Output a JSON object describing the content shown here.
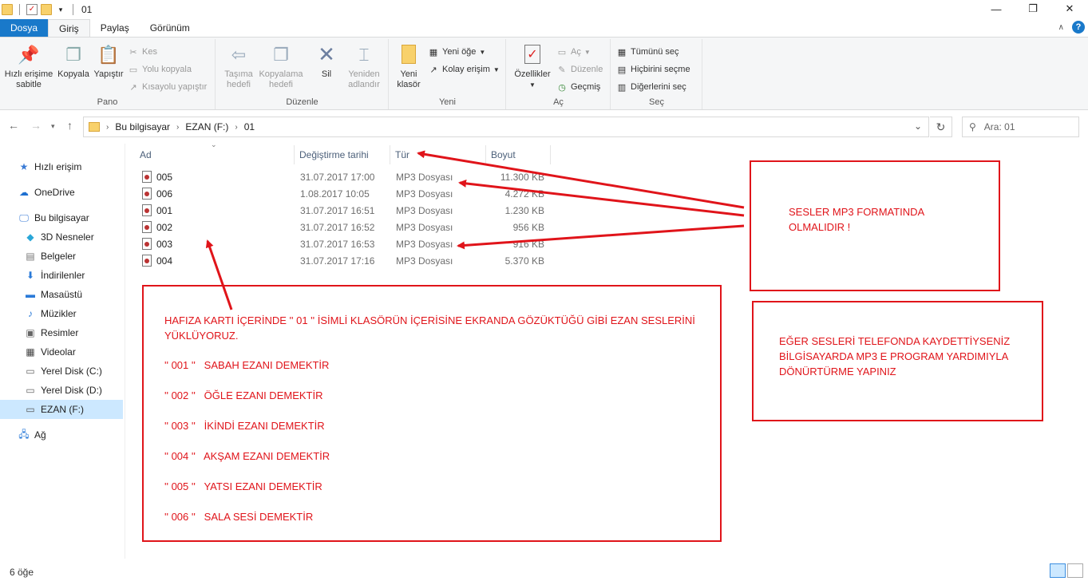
{
  "window": {
    "title": "01",
    "minimize": "—",
    "restore": "❐",
    "close": "✕"
  },
  "tabs": [
    "Dosya",
    "Giriş",
    "Paylaş",
    "Görünüm"
  ],
  "ribbon": {
    "pano": {
      "label": "Pano",
      "pin": "Hızlı erişime sabitle",
      "pin_l1": "Hızlı erişime",
      "pin_l2": "sabitle",
      "copy": "Kopyala",
      "paste": "Yapıştır",
      "cut": "Kes",
      "copy_path": "Yolu kopyala",
      "paste_shortcut": "Kısayolu yapıştır"
    },
    "duzenle": {
      "label": "Düzenle",
      "move_l1": "Taşıma",
      "move_l2": "hedefi",
      "copyto_l1": "Kopyalama",
      "copyto_l2": "hedefi",
      "delete": "Sil",
      "rename_l1": "Yeniden",
      "rename_l2": "adlandır"
    },
    "yeni": {
      "label": "Yeni",
      "new_folder_l1": "Yeni",
      "new_folder_l2": "klasör",
      "new_item": "Yeni öğe",
      "easy_access": "Kolay erişim"
    },
    "ac": {
      "label": "Aç",
      "properties": "Özellikler",
      "open": "Aç",
      "edit": "Düzenle",
      "history": "Geçmiş"
    },
    "sec": {
      "label": "Seç",
      "select_all": "Tümünü seç",
      "select_none": "Hiçbirini seçme",
      "invert": "Diğerlerini seç"
    }
  },
  "address": {
    "crumbs": [
      "Bu bilgisayar",
      "EZAN (F:)",
      "01"
    ],
    "search_placeholder": "Ara: 01"
  },
  "sidebar": {
    "items": [
      {
        "label": "Hızlı erişim",
        "icon": "star-icon"
      },
      {
        "label": "OneDrive",
        "icon": "cloud-icon"
      },
      {
        "label": "Bu bilgisayar",
        "icon": "computer-icon"
      },
      {
        "label": "3D Nesneler",
        "icon": "cube-icon"
      },
      {
        "label": "Belgeler",
        "icon": "document-icon"
      },
      {
        "label": "İndirilenler",
        "icon": "download-icon"
      },
      {
        "label": "Masaüstü",
        "icon": "desktop-icon"
      },
      {
        "label": "Müzikler",
        "icon": "music-icon"
      },
      {
        "label": "Resimler",
        "icon": "picture-icon"
      },
      {
        "label": "Videolar",
        "icon": "video-icon"
      },
      {
        "label": "Yerel Disk (C:)",
        "icon": "drive-icon"
      },
      {
        "label": "Yerel Disk (D:)",
        "icon": "drive-icon"
      },
      {
        "label": "EZAN (F:)",
        "icon": "usb-drive-icon"
      },
      {
        "label": "Ağ",
        "icon": "network-icon"
      }
    ]
  },
  "columns": {
    "name": "Ad",
    "modified": "Değiştirme tarihi",
    "type": "Tür",
    "size": "Boyut"
  },
  "files": [
    {
      "name": "005",
      "date": "31.07.2017 17:00",
      "type": "MP3 Dosyası",
      "size": "11.300 KB"
    },
    {
      "name": "006",
      "date": "1.08.2017 10:05",
      "type": "MP3 Dosyası",
      "size": "4.272 KB"
    },
    {
      "name": "001",
      "date": "31.07.2017 16:51",
      "type": "MP3 Dosyası",
      "size": "1.230 KB"
    },
    {
      "name": "002",
      "date": "31.07.2017 16:52",
      "type": "MP3 Dosyası",
      "size": "956 KB"
    },
    {
      "name": "003",
      "date": "31.07.2017 16:53",
      "type": "MP3 Dosyası",
      "size": "916 KB"
    },
    {
      "name": "004",
      "date": "31.07.2017 17:16",
      "type": "MP3 Dosyası",
      "size": "5.370 KB"
    }
  ],
  "annotations": {
    "mp3_format_l1": "SESLER MP3 FORMATINDA",
    "mp3_format_l2": "OLMALIDIR !",
    "main_l1": "HAFIZA KARTI İÇERİNDE '' 01 ''  İSİMLİ KLASÖRÜN İÇERİSİNE EKRANDA GÖZÜKTÜĞÜ GİBİ EZAN SESLERİNİ",
    "main_l2": "YÜKLÜYORUZ.",
    "items": [
      "'' 001 ''   SABAH EZANI DEMEKTİR",
      "'' 002 ''   ÖĞLE EZANI DEMEKTİR",
      "'' 003 ''   İKİNDİ EZANI DEMEKTİR",
      "'' 004 ''   AKŞAM EZANI DEMEKTİR",
      "'' 005 ''   YATSI EZANI DEMEKTİR",
      "'' 006 ''   SALA SESİ DEMEKTİR"
    ],
    "phone_l1": "EĞER SESLERİ TELEFONDA KAYDETTİYSENİZ",
    "phone_l2": "BİLGİSAYARDA MP3 E PROGRAM YARDIMIYLA",
    "phone_l3": "DÖNÜRTÜRME YAPINIZ"
  },
  "status": {
    "count": "6 öğe"
  },
  "colors": {
    "accent": "#1979ca",
    "annotation_red": "#e0141a",
    "selected_bg": "#cce8ff"
  }
}
